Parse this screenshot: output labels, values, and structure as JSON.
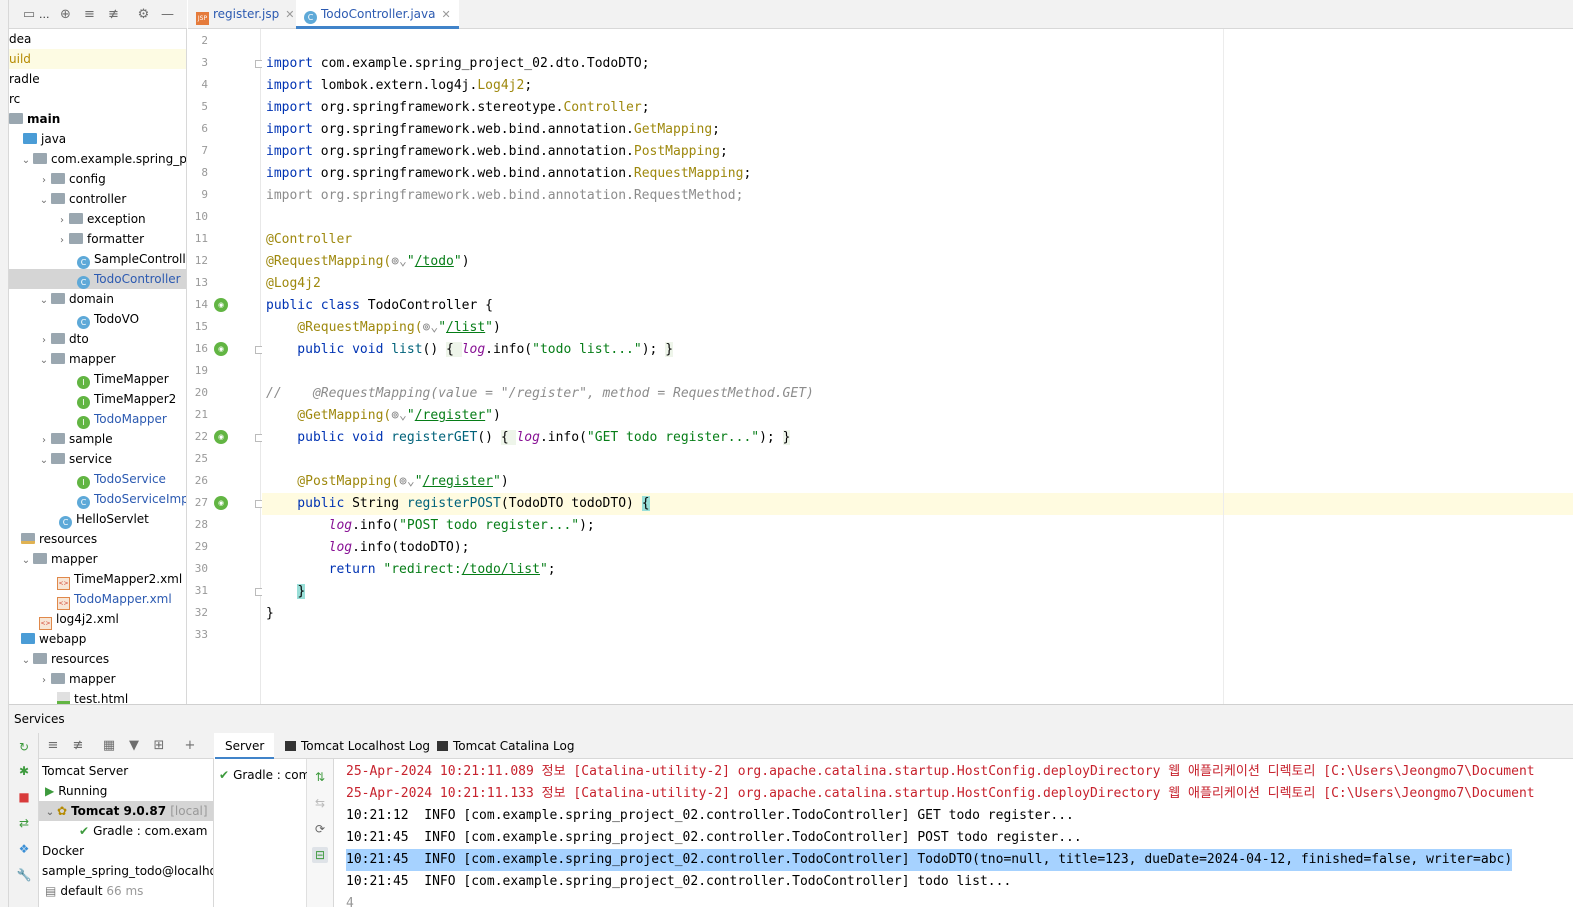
{
  "project_toolbar": {
    "title": "..."
  },
  "tree": {
    "items": [
      {
        "label": "dea"
      },
      {
        "label": "uild"
      },
      {
        "label": "radle"
      },
      {
        "label": "rc"
      },
      {
        "label": "main"
      },
      {
        "label": "java"
      },
      {
        "label": "com.example.spring_pro"
      },
      {
        "label": "config"
      },
      {
        "label": "controller"
      },
      {
        "label": "exception"
      },
      {
        "label": "formatter"
      },
      {
        "label": "SampleController"
      },
      {
        "label": "TodoController"
      },
      {
        "label": "domain"
      },
      {
        "label": "TodoVO"
      },
      {
        "label": "dto"
      },
      {
        "label": "mapper"
      },
      {
        "label": "TimeMapper"
      },
      {
        "label": "TimeMapper2"
      },
      {
        "label": "TodoMapper"
      },
      {
        "label": "sample"
      },
      {
        "label": "service"
      },
      {
        "label": "TodoService"
      },
      {
        "label": "TodoServiceImpl"
      },
      {
        "label": "HelloServlet"
      },
      {
        "label": "resources"
      },
      {
        "label": "mapper"
      },
      {
        "label": "TimeMapper2.xml"
      },
      {
        "label": "TodoMapper.xml"
      },
      {
        "label": "log4j2.xml"
      },
      {
        "label": "webapp"
      },
      {
        "label": "resources"
      },
      {
        "label": "mapper"
      },
      {
        "label": "test.html"
      }
    ]
  },
  "editor_tabs": [
    {
      "label": "register.jsp",
      "icon": "JSP"
    },
    {
      "label": "TodoController.java",
      "icon": "C"
    }
  ],
  "code": {
    "line_numbers": [
      "2",
      "3",
      "4",
      "5",
      "6",
      "7",
      "8",
      "9",
      "10",
      "11",
      "12",
      "13",
      "14",
      "15",
      "16",
      "19",
      "20",
      "21",
      "22",
      "25",
      "26",
      "27",
      "28",
      "29",
      "30",
      "31",
      "32",
      "33"
    ],
    "lines": {
      "l3a": "import ",
      "l3b": "com.example.spring_project_02.dto.TodoDTO;",
      "l4a": "import ",
      "l4b": "lombok.extern.log4j.",
      "l4c": "Log4j2",
      "l4d": ";",
      "l5a": "import ",
      "l5b": "org.springframework.stereotype.",
      "l5c": "Controller",
      "l5d": ";",
      "l6a": "import ",
      "l6b": "org.springframework.web.bind.annotation.",
      "l6c": "GetMapping",
      "l6d": ";",
      "l7a": "import ",
      "l7b": "org.springframework.web.bind.annotation.",
      "l7c": "PostMapping",
      "l7d": ";",
      "l8a": "import ",
      "l8b": "org.springframework.web.bind.annotation.",
      "l8c": "RequestMapping",
      "l8d": ";",
      "l9": "import org.springframework.web.bind.annotation.RequestMethod;",
      "l11": "@Controller",
      "l12a": "@RequestMapping(",
      "l12b": "\"",
      "l12c": "/todo",
      "l12d": "\"",
      "l12e": ")",
      "l13": "@Log4j2",
      "l14a": "public class ",
      "l14b": "TodoController {",
      "l15a": "    @RequestMapping(",
      "l15b": "\"",
      "l15c": "/list",
      "l15d": "\"",
      "l15e": ")",
      "l16a": "    public void ",
      "l16b": "list",
      "l16c": "() ",
      "l16d": "{ ",
      "l16e": "log",
      "l16f": ".info(",
      "l16g": "\"todo list...\"",
      "l16h": "); ",
      "l16i": "}",
      "l20": "//    @RequestMapping(value = \"/register\", method = RequestMethod.GET)",
      "l21a": "    @GetMapping(",
      "l21b": "\"",
      "l21c": "/register",
      "l21d": "\"",
      "l21e": ")",
      "l22a": "    public void ",
      "l22b": "registerGET",
      "l22c": "() ",
      "l22d": "{ ",
      "l22e": "log",
      "l22f": ".info(",
      "l22g": "\"GET todo register...\"",
      "l22h": "); ",
      "l22i": "}",
      "l26a": "    @PostMapping(",
      "l26b": "\"",
      "l26c": "/register",
      "l26d": "\"",
      "l26e": ")",
      "l27a": "    public ",
      "l27b": "String ",
      "l27c": "registerPOST",
      "l27d": "(TodoDTO todoDTO) ",
      "l27e": "{",
      "l28a": "        ",
      "l28b": "log",
      "l28c": ".info(",
      "l28d": "\"POST todo register...\"",
      "l28e": ");",
      "l29a": "        ",
      "l29b": "log",
      "l29c": ".info(todoDTO);",
      "l30a": "        return ",
      "l30b": "\"redirect:",
      "l30c": "/todo/list",
      "l30d": "\"",
      "l30e": ";",
      "l31a": "    ",
      "l31b": "}",
      "l32": "}"
    }
  },
  "services": {
    "title": "Services",
    "tree": [
      {
        "label": "Tomcat Server"
      },
      {
        "label": "Running"
      },
      {
        "label": "Tomcat 9.0.87",
        "suffix": "[local]"
      },
      {
        "label": "Gradle : com.exam"
      },
      {
        "label": "Docker"
      },
      {
        "label": "sample_spring_todo@localhost"
      },
      {
        "label": "default",
        "suffix": "66 ms"
      }
    ],
    "tabs": [
      {
        "label": "Server"
      },
      {
        "label": "Tomcat Localhost Log"
      },
      {
        "label": "Tomcat Catalina Log"
      }
    ],
    "deployment": "Gradle : com",
    "log_lines": [
      "25-Apr-2024 10:21:11.089 정보 [Catalina-utility-2] org.apache.catalina.startup.HostConfig.deployDirectory 웹 애플리케이션 디렉토리 [C:\\Users\\Jeongmo7\\Document",
      "25-Apr-2024 10:21:11.133 정보 [Catalina-utility-2] org.apache.catalina.startup.HostConfig.deployDirectory 웹 애플리케이션 디렉토리 [C:\\Users\\Jeongmo7\\Document",
      "10:21:12  INFO [com.example.spring_project_02.controller.TodoController] GET todo register...",
      "10:21:45  INFO [com.example.spring_project_02.controller.TodoController] POST todo register...",
      "10:21:45  INFO [com.example.spring_project_02.controller.TodoController] TodoDTO(tno=null, title=123, dueDate=2024-04-12, finished=false, writer=abc)",
      "10:21:45  INFO [com.example.spring_project_02.controller.TodoController] todo list...",
      "4"
    ]
  }
}
